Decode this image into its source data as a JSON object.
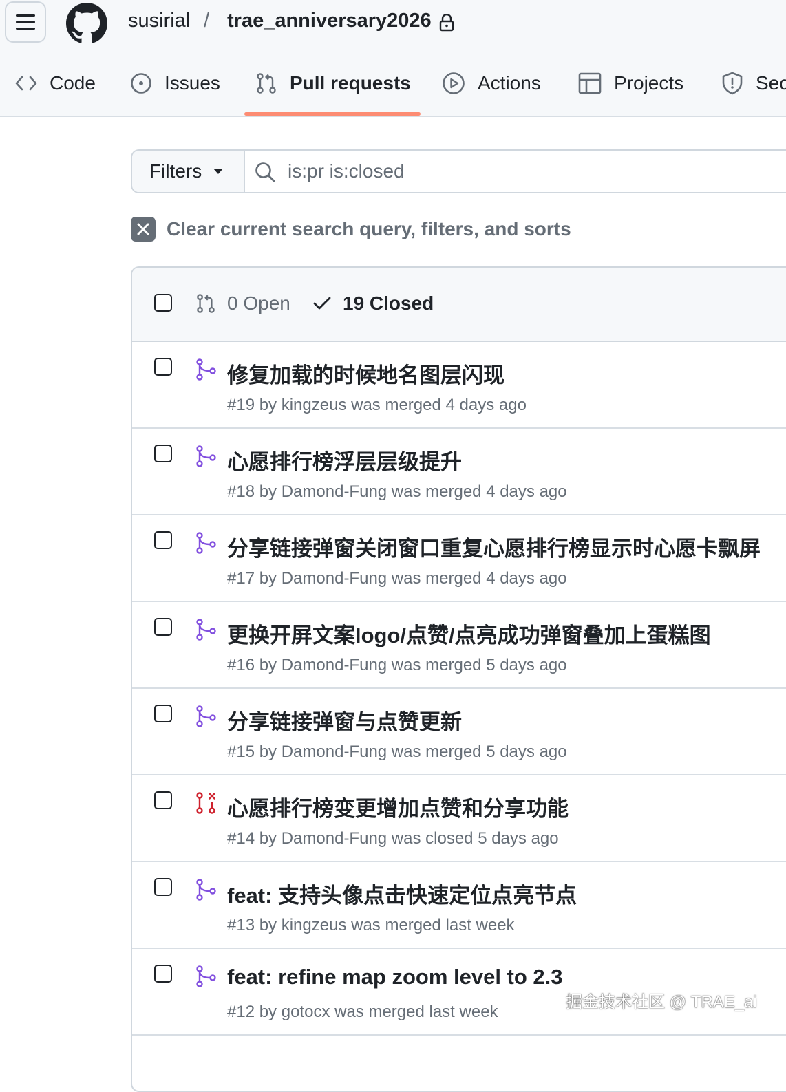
{
  "header": {
    "owner": "susirial",
    "separator": "/",
    "repo": "trae_anniversary2026",
    "tabs": [
      {
        "label": "Code",
        "icon": "code-icon"
      },
      {
        "label": "Issues",
        "icon": "issue-opened-icon"
      },
      {
        "label": "Pull requests",
        "icon": "git-pull-request-icon",
        "active": true
      },
      {
        "label": "Actions",
        "icon": "play-icon"
      },
      {
        "label": "Projects",
        "icon": "table-icon"
      },
      {
        "label": "Sec",
        "icon": "shield-icon"
      }
    ]
  },
  "filter_bar": {
    "filters_label": "Filters",
    "query": "is:pr is:closed"
  },
  "clear_label": "Clear current search query, filters, and sorts",
  "list": {
    "open_label": "0 Open",
    "closed_label": "19 Closed",
    "items": [
      {
        "title": "修复加载的时候地名图层闪现",
        "meta": "#19 by kingzeus was merged 4 days ago",
        "state": "merged"
      },
      {
        "title": "心愿排行榜浮层层级提升",
        "meta": "#18 by Damond-Fung was merged 4 days ago",
        "state": "merged"
      },
      {
        "title": "分享链接弹窗关闭窗口重复心愿排行榜显示时心愿卡飘屏",
        "meta": "#17 by Damond-Fung was merged 4 days ago",
        "state": "merged"
      },
      {
        "title": "更换开屏文案logo/点赞/点亮成功弹窗叠加上蛋糕图",
        "meta": "#16 by Damond-Fung was merged 5 days ago",
        "state": "merged"
      },
      {
        "title": "分享链接弹窗与点赞更新",
        "meta": "#15 by Damond-Fung was merged 5 days ago",
        "state": "merged"
      },
      {
        "title": "心愿排行榜变更增加点赞和分享功能",
        "meta": "#14 by Damond-Fung was closed 5 days ago",
        "state": "closed"
      },
      {
        "title": "feat: 支持头像点击快速定位点亮节点",
        "meta": "#13 by kingzeus was merged last week",
        "state": "merged"
      },
      {
        "title": "feat: refine map zoom level to 2.3",
        "meta": "#12 by gotocx was merged last week",
        "state": "merged"
      }
    ]
  },
  "watermark": "掘金技术社区 @ TRAE_ai",
  "colors": {
    "merged": "#8250df",
    "closed": "#cf222e",
    "active_tab_underline": "#fd8c73",
    "muted_text": "#656d76"
  }
}
